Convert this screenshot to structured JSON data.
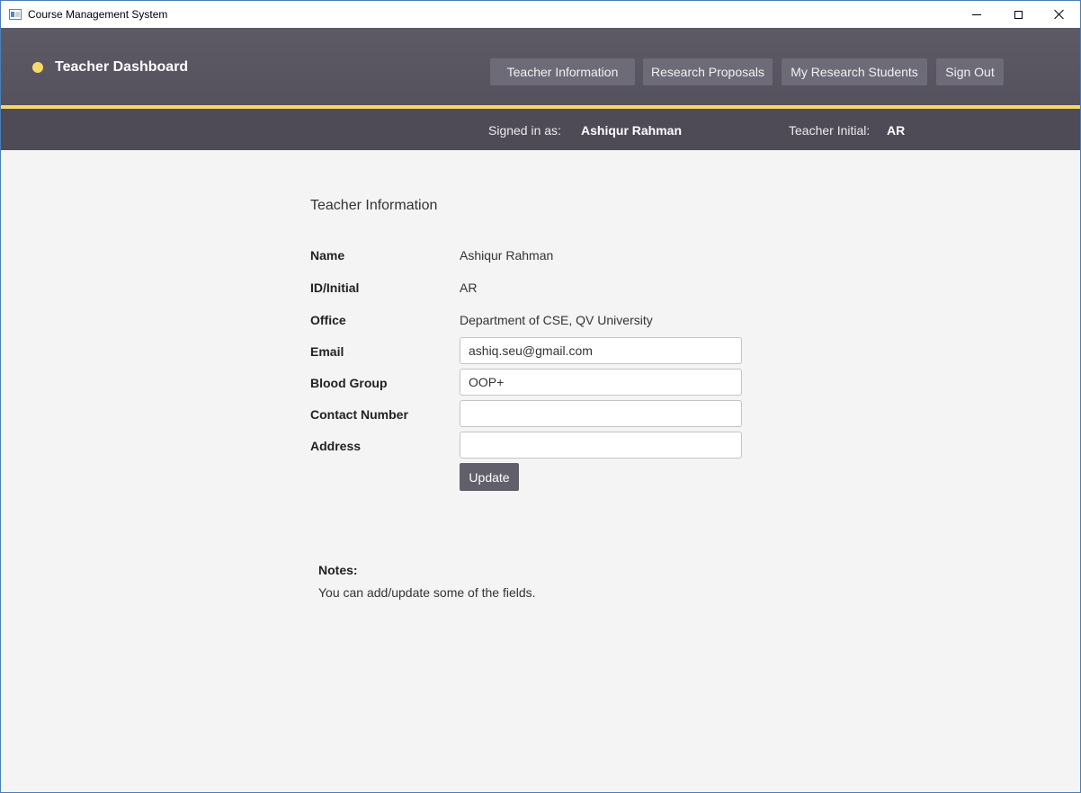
{
  "window": {
    "title": "Course Management System"
  },
  "header": {
    "brand": "Teacher Dashboard",
    "nav": [
      {
        "label": "Teacher Information"
      },
      {
        "label": "Research Proposals"
      },
      {
        "label": "My Research Students"
      },
      {
        "label": "Sign Out"
      }
    ]
  },
  "subbar": {
    "signed_in_label": "Signed in as:",
    "signed_in_value": "Ashiqur Rahman",
    "initial_label": "Teacher Initial:",
    "initial_value": "AR"
  },
  "main": {
    "section_title": "Teacher Information",
    "fields": [
      {
        "label": "Name",
        "value": "Ashiqur Rahman"
      },
      {
        "label": "ID/Initial",
        "value": "AR"
      },
      {
        "label": "Office",
        "value": "Department of CSE, QV University"
      },
      {
        "label": "Email",
        "value": "ashiq.seu@gmail.com"
      },
      {
        "label": "Blood Group",
        "value": "OOP+"
      },
      {
        "label": "Contact Number",
        "value": ""
      },
      {
        "label": "Address",
        "value": ""
      }
    ],
    "update_label": "Update"
  },
  "notes": {
    "title": "Notes:",
    "text": "You can add/update some of the fields."
  },
  "colors": {
    "header": "#5a5763",
    "accent": "#f5d668",
    "subbar": "#4e4b56",
    "button": "#6e6b78"
  }
}
